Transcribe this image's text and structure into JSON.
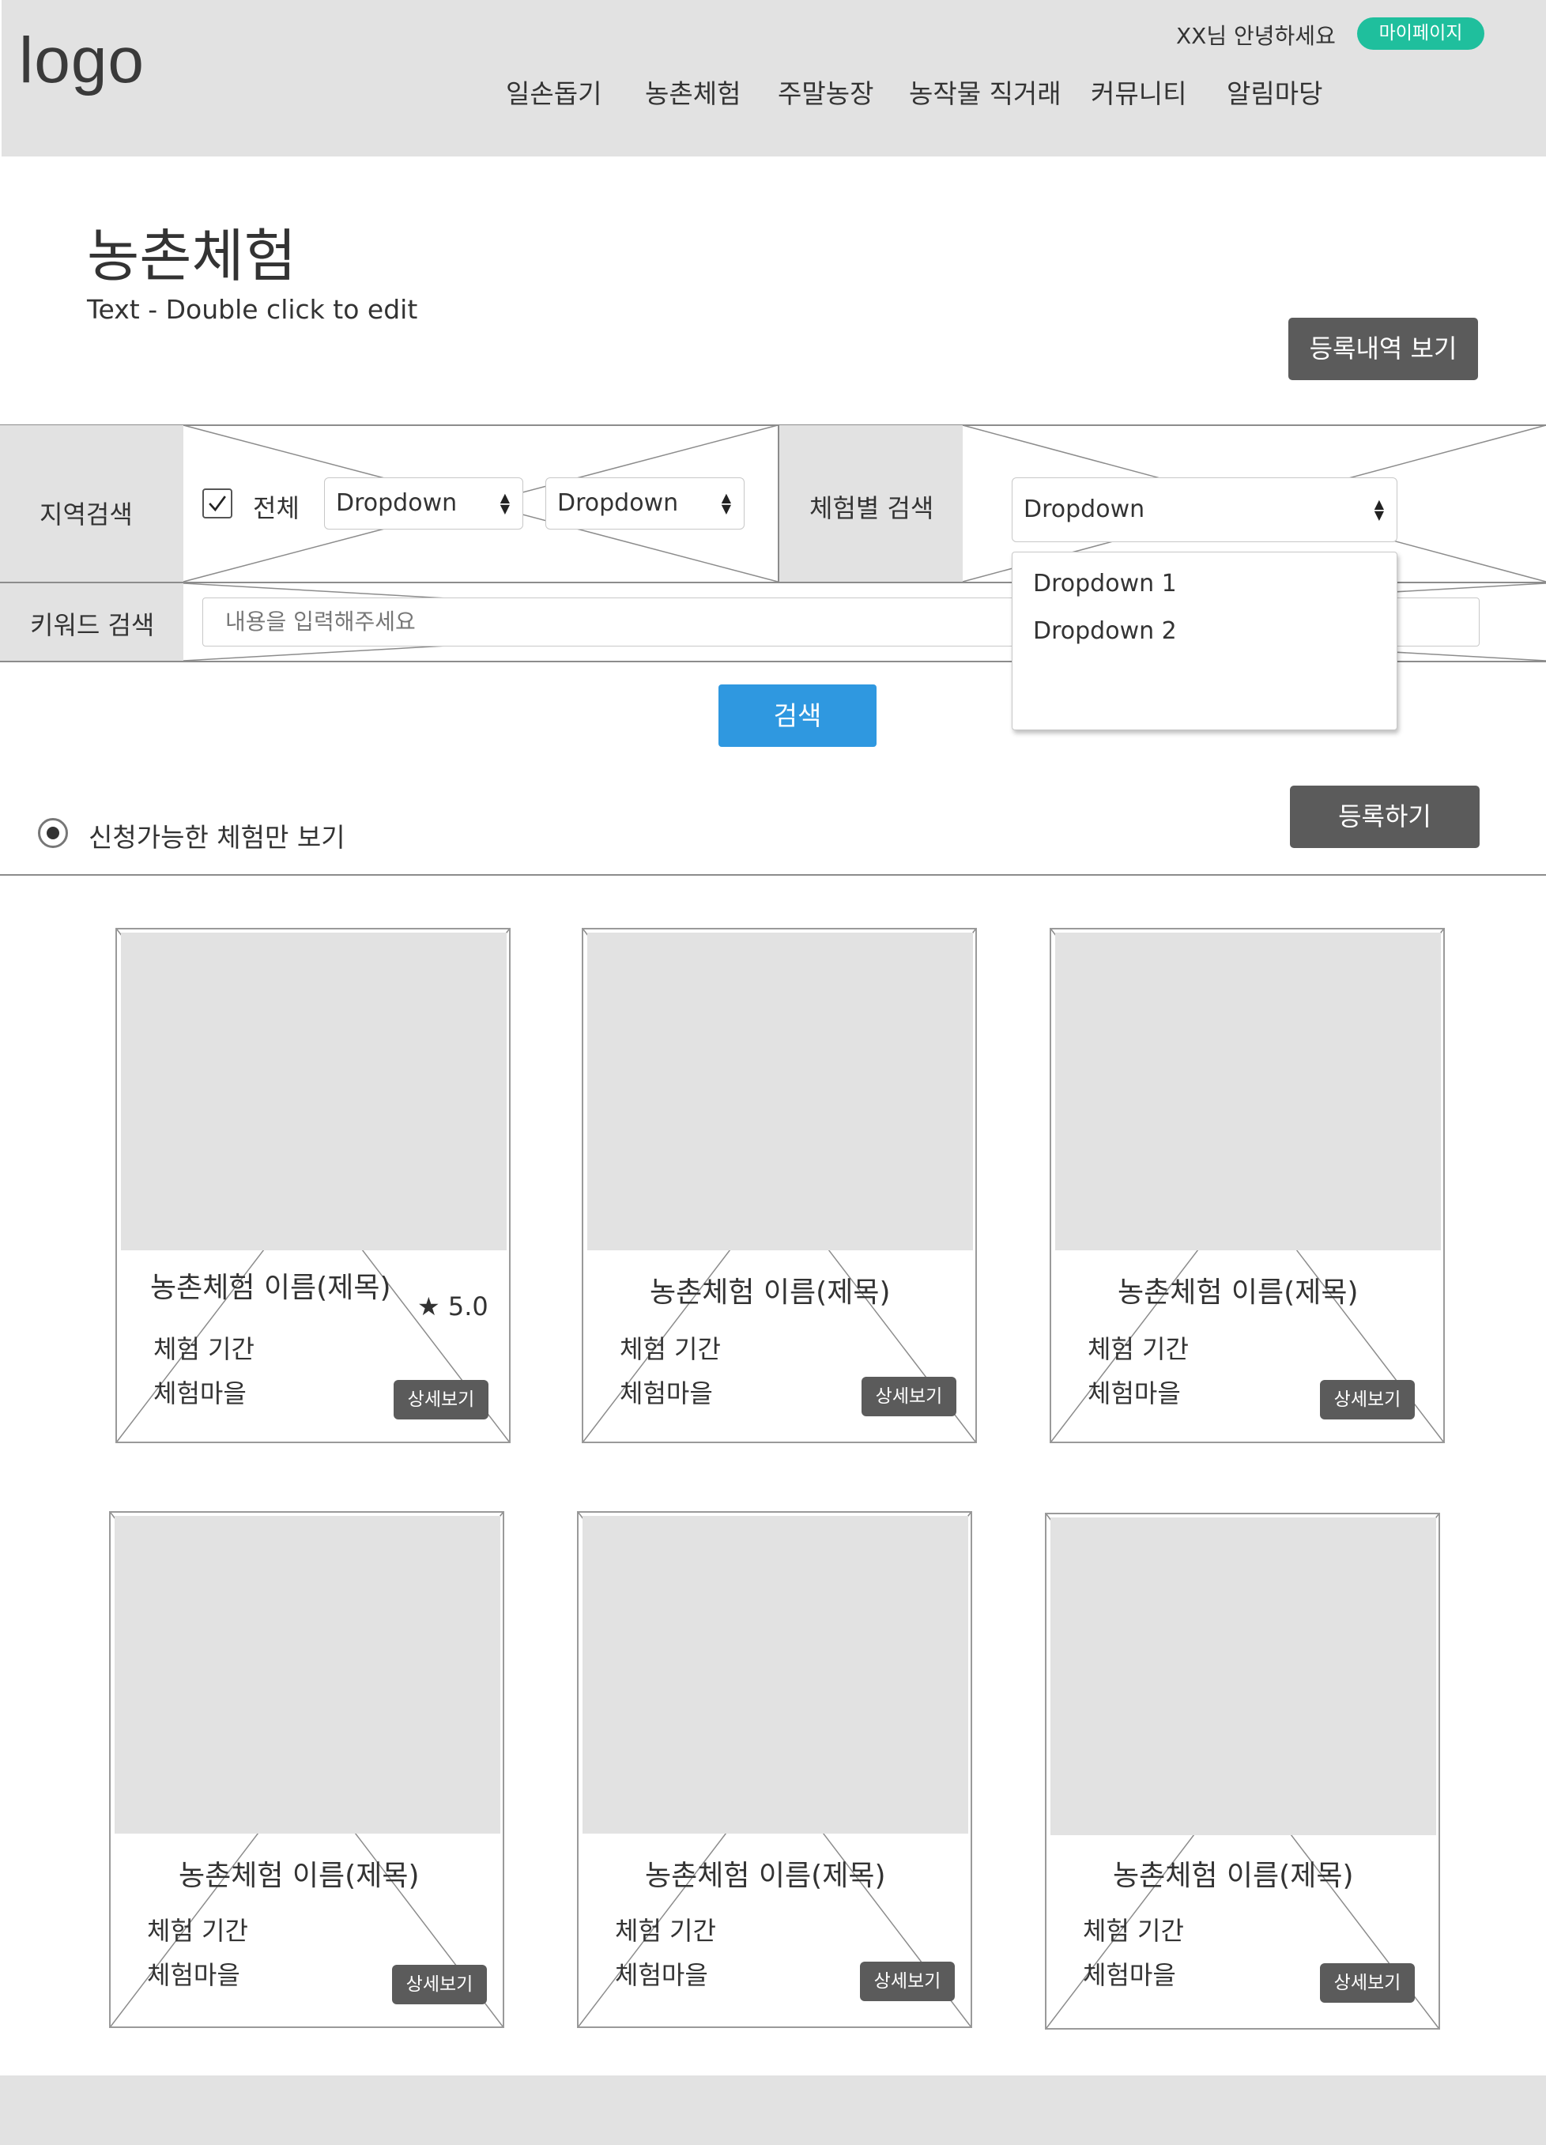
{
  "header": {
    "logo": "logo",
    "greeting": "XX님 안녕하세요",
    "mypage_label": "마이페이지",
    "nav": [
      "일손돕기",
      "농촌체험",
      "주말농장",
      "농작물 직거래",
      "커뮤니티",
      "알림마당"
    ]
  },
  "page": {
    "title": "농촌체험",
    "subtitle": "Text - Double click to edit",
    "history_button": "등록내역 보기"
  },
  "search": {
    "region_label": "지역검색",
    "all_checkbox_label": "전체",
    "all_checked": true,
    "region_dropdown_1": "Dropdown",
    "region_dropdown_2": "Dropdown",
    "type_label": "체험별 검색",
    "type_dropdown": "Dropdown",
    "type_options": [
      "Dropdown 1",
      "Dropdown 2"
    ],
    "keyword_label": "키워드 검색",
    "keyword_placeholder": "내용을 입력해주세요",
    "search_button": "검색"
  },
  "filter": {
    "available_only_label": "신청가능한 체험만 보기",
    "register_button": "등록하기"
  },
  "cards": [
    {
      "title": "농촌체험 이름(제목)",
      "period": "체험 기간",
      "village": "체험마을",
      "rating": "★ 5.0",
      "detail": "상세보기"
    },
    {
      "title": "농촌체험 이름(제목)",
      "period": "체험 기간",
      "village": "체험마을",
      "detail": "상세보기"
    },
    {
      "title": "농촌체험 이름(제목)",
      "period": "체험 기간",
      "village": "체험마을",
      "detail": "상세보기"
    },
    {
      "title": "농촌체험 이름(제목)",
      "period": "체험 기간",
      "village": "체험마을",
      "detail": "상세보기"
    },
    {
      "title": "농촌체험 이름(제목)",
      "period": "체험 기간",
      "village": "체험마을",
      "detail": "상세보기"
    },
    {
      "title": "농촌체험 이름(제목)",
      "period": "체험 기간",
      "village": "체험마을",
      "detail": "상세보기"
    }
  ],
  "colors": {
    "accent_teal": "#1fbf9d",
    "search_blue": "#2f98e0",
    "button_gray": "#5b5b5b",
    "placeholder_gray": "#e2e2e2"
  }
}
